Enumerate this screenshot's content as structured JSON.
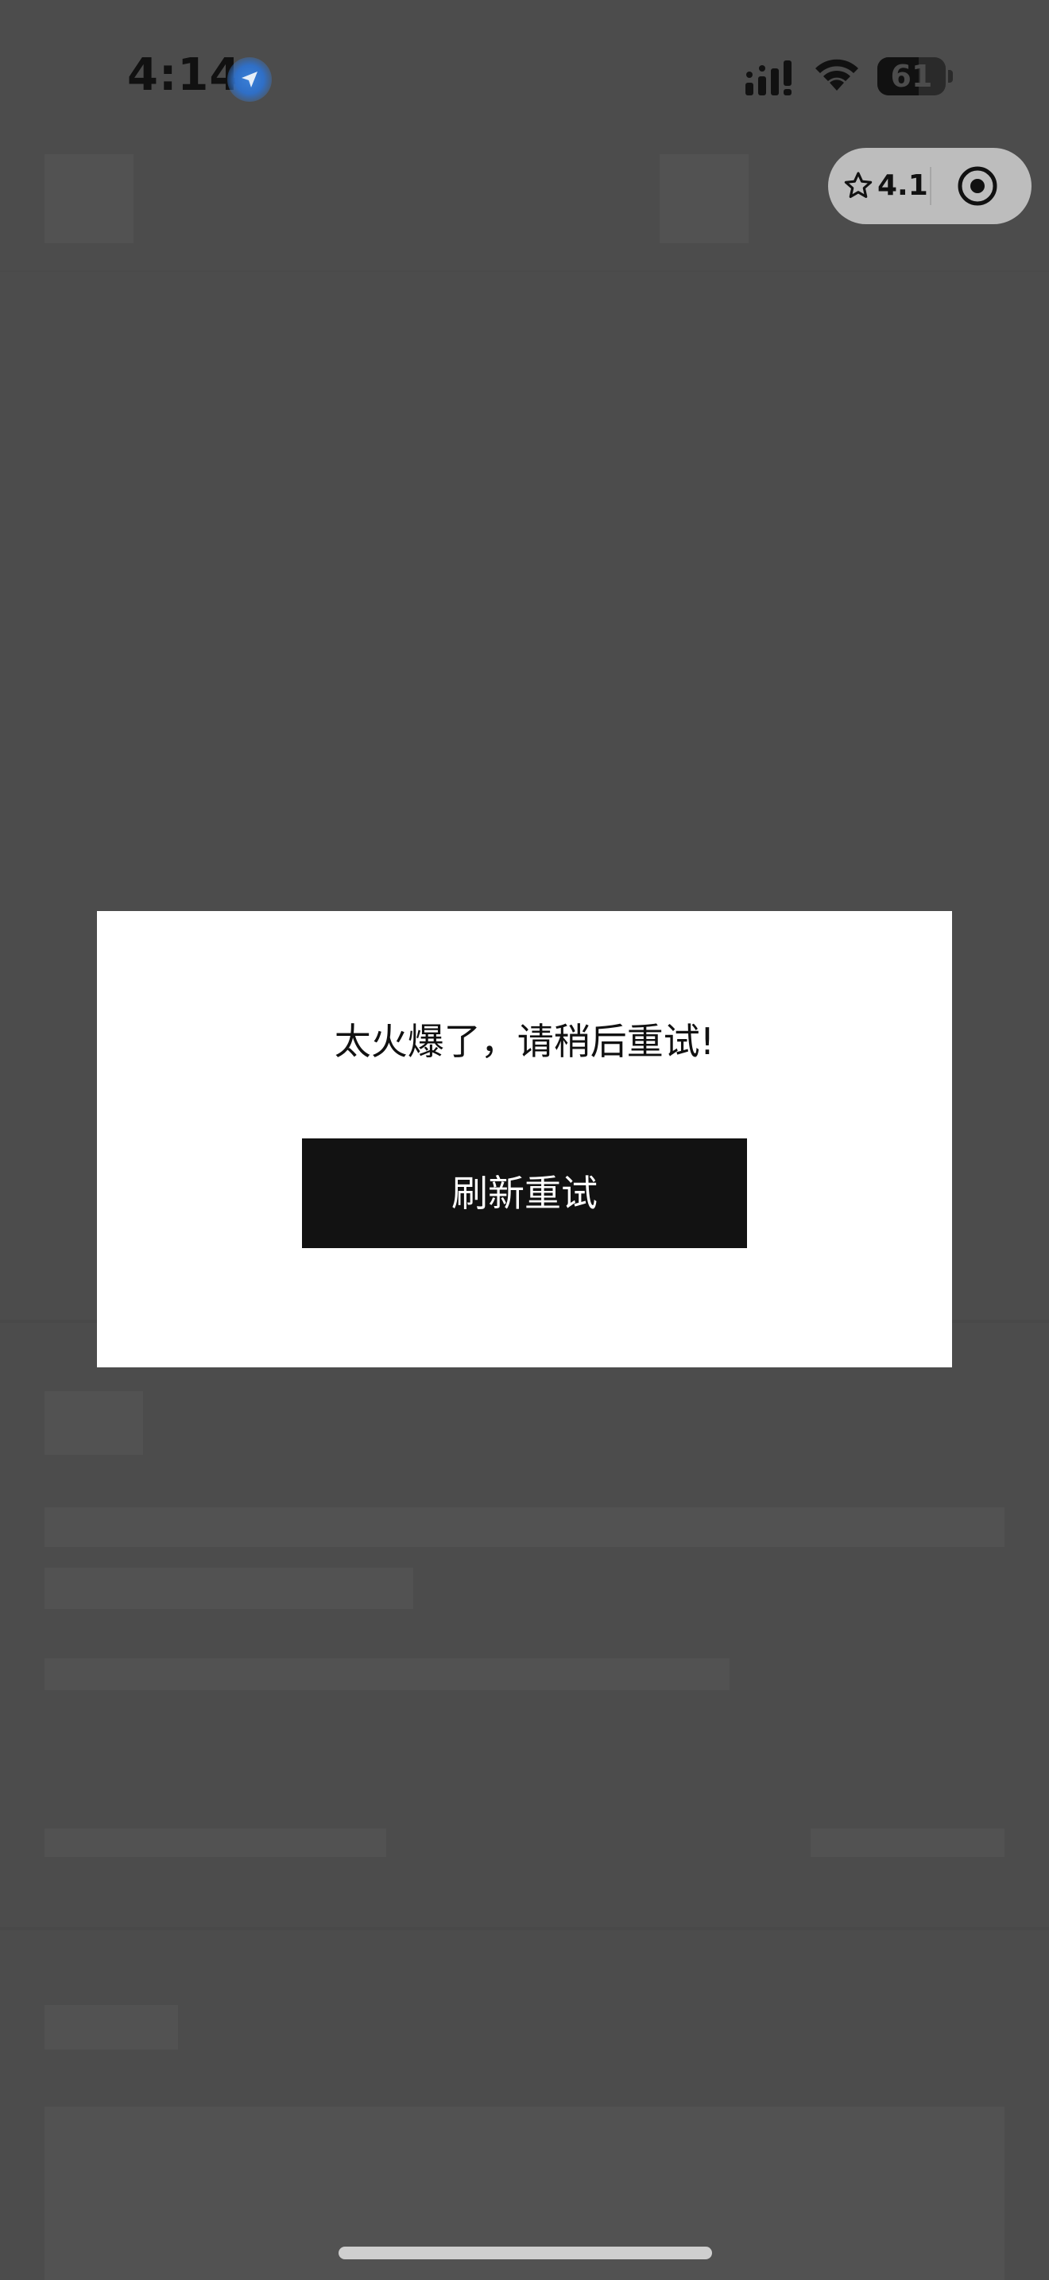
{
  "status_bar": {
    "time": "4:14",
    "battery_level": "61",
    "battery_fraction": 0.61
  },
  "capsule": {
    "rating": "4.1",
    "star_icon": "star-outline-icon",
    "target_icon": "record-target-icon"
  },
  "modal": {
    "message": "太火爆了，请稍后重试!",
    "button_label": "刷新重试"
  },
  "colors": {
    "overlay": "#4c4c4c",
    "skeleton": "#525252",
    "modal_bg": "#ffffff",
    "button_bg": "#121212",
    "button_text": "#ffffff"
  }
}
